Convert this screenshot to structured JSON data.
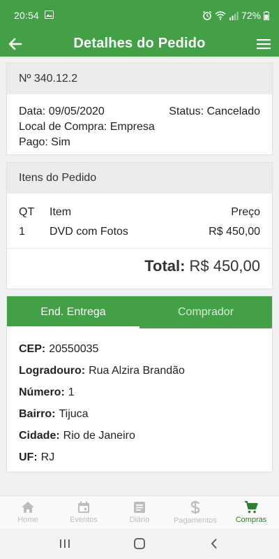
{
  "status_bar": {
    "time": "20:54",
    "battery": "72%",
    "icons": [
      "image-icon",
      "alarm-icon",
      "wifi-icon",
      "signal-icon",
      "battery-icon"
    ]
  },
  "app_bar": {
    "title": "Detalhes do Pedido",
    "back_icon": "arrow-left-icon",
    "menu_icon": "hamburger-menu-icon"
  },
  "order": {
    "number": "Nº 340.12.2",
    "date_label": "Data:",
    "date_value": "09/05/2020",
    "status_label": "Status:",
    "status_value": "Cancelado",
    "place_label": "Local de Compra:",
    "place_value": "Empresa",
    "paid_label": "Pago:",
    "paid_value": "Sim"
  },
  "items": {
    "title": "Itens do Pedido",
    "headers": {
      "qt": "QT",
      "item": "Item",
      "price": "Preço"
    },
    "rows": [
      {
        "qt": "1",
        "item": "DVD com Fotos",
        "price": "R$ 450,00"
      }
    ],
    "total_label": "Total:",
    "total_value": "R$ 450,00"
  },
  "tabs": [
    {
      "label": "End. Entrega",
      "active": true
    },
    {
      "label": "Comprador",
      "active": false
    }
  ],
  "address": {
    "cep_label": "CEP:",
    "cep_value": "20550035",
    "street_label": "Logradouro:",
    "street_value": "Rua Alzira Brandão",
    "number_label": "Número:",
    "number_value": "1",
    "district_label": "Bairro:",
    "district_value": "Tijuca",
    "city_label": "Cidade:",
    "city_value": "Rio de Janeiro",
    "uf_label": "UF:",
    "uf_value": "RJ"
  },
  "bottom_nav": [
    {
      "label": "Home",
      "icon": "home-icon",
      "active": false
    },
    {
      "label": "Eventos",
      "icon": "calendar-icon",
      "active": false
    },
    {
      "label": "Diário",
      "icon": "notes-icon",
      "active": false
    },
    {
      "label": "Pagamentos",
      "icon": "dollar-icon",
      "active": false
    },
    {
      "label": "Compras",
      "icon": "cart-icon",
      "active": true
    }
  ],
  "colors": {
    "primary": "#43a047",
    "nav_active": "#2e7d32",
    "nav_inactive": "#bdbdbd",
    "card_header": "#ececec"
  }
}
